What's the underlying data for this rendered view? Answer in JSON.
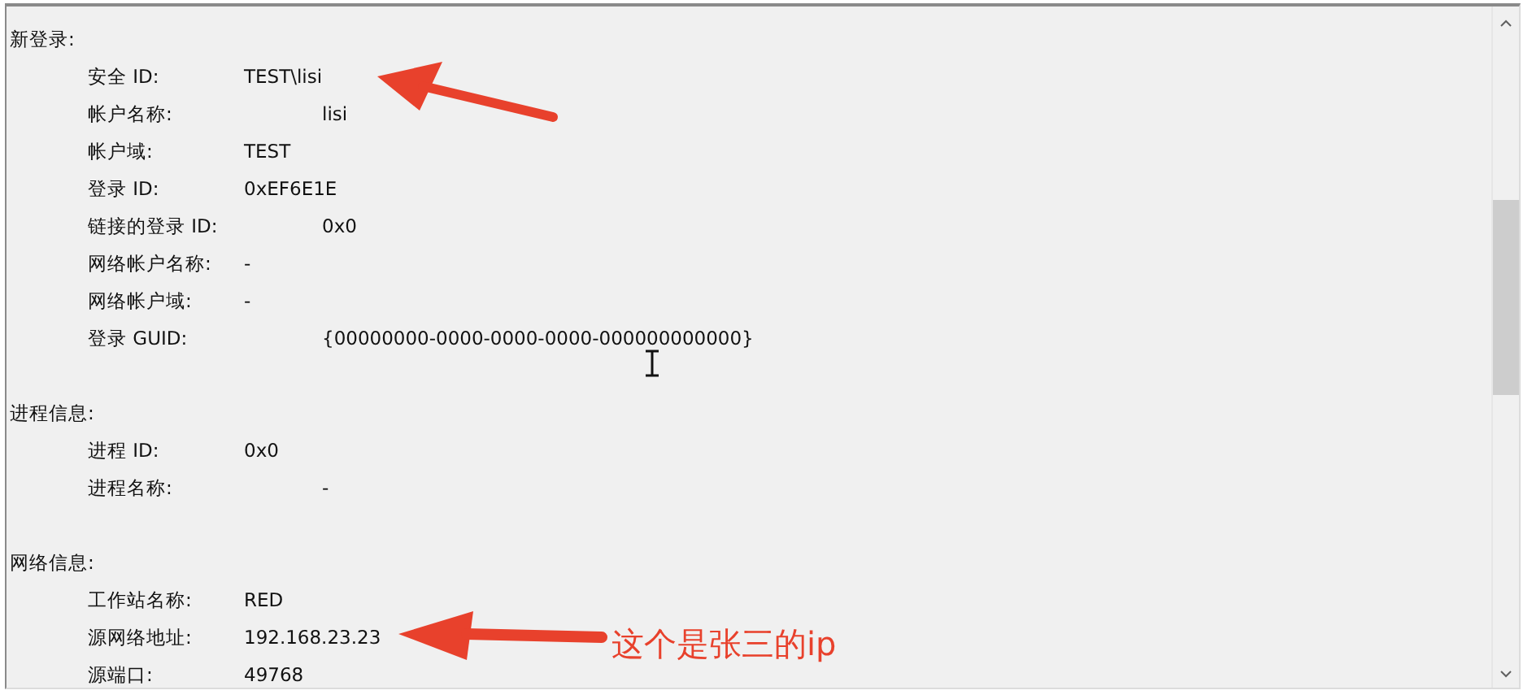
{
  "sections": [
    {
      "title": "新登录:",
      "fields": [
        {
          "label": "安全 ID:",
          "value": "TEST\\lisi",
          "kind": "near"
        },
        {
          "label": "帐户名称:",
          "value": "lisi",
          "kind": "far"
        },
        {
          "label": "帐户域:",
          "value": "TEST",
          "kind": "near"
        },
        {
          "label": "登录 ID:",
          "value": "0xEF6E1E",
          "kind": "near"
        },
        {
          "label": "链接的登录 ID:",
          "value": "0x0",
          "kind": "far"
        },
        {
          "label": "网络帐户名称:",
          "value": "-",
          "kind": "near"
        },
        {
          "label": "网络帐户域:",
          "value": "-",
          "kind": "near"
        },
        {
          "label": "登录 GUID:",
          "value": "{00000000-0000-0000-0000-000000000000}",
          "kind": "far"
        }
      ]
    },
    {
      "title": "进程信息:",
      "fields": [
        {
          "label": "进程 ID:",
          "value": "0x0",
          "kind": "near"
        },
        {
          "label": "进程名称:",
          "value": "-",
          "kind": "far"
        }
      ]
    },
    {
      "title": "网络信息:",
      "fields": [
        {
          "label": "工作站名称:",
          "value": "RED",
          "kind": "near"
        },
        {
          "label": "源网络地址:",
          "value": "192.168.23.23",
          "kind": "near"
        },
        {
          "label": "源端口:",
          "value": "49768",
          "kind": "near"
        }
      ]
    }
  ],
  "callout": {
    "text": "这个是张三的ip"
  }
}
